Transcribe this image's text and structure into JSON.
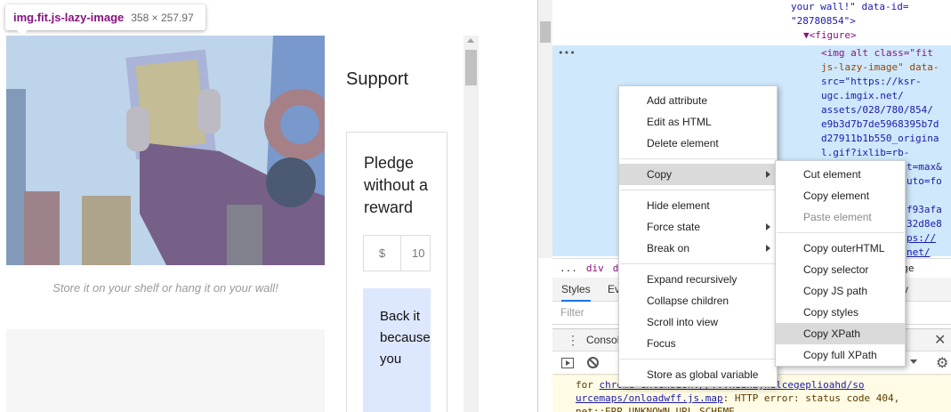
{
  "tooltip": {
    "selector": "img.fit.js-lazy-image",
    "dimensions": "358 × 257.97"
  },
  "page": {
    "caption": "Store it on your shelf or hang it on your wall!",
    "support_heading": "Support",
    "pledge_title": "Pledge without a reward",
    "currency": "$",
    "amount_value": "10",
    "back_button": "Back it because you"
  },
  "devtools": {
    "tree": {
      "l1": "your wall!\" data-id=",
      "l2": "\"28780854\">",
      "figure": "▼<figure>",
      "img": [
        "<img alt class=\"fit",
        "js-lazy-image\" data-",
        "src=\"https://ksr-",
        "ugc.imgix.net/",
        "assets/028/780/854/",
        "e9b3d7b7de5968395b7d",
        "d27911b1b550_origina",
        "l.gif?ixlib=rb-",
        "t=max&",
        "uto=fo",
        "",
        "f93afa",
        "32d8e8",
        "ps://",
        "net/"
      ],
      "ellipsis": "•••"
    },
    "breadcrumb": [
      "...",
      "div",
      "div",
      "mage"
    ],
    "styles_tabs": {
      "styles": "Styles",
      "event": "Eve",
      "access": "ity"
    },
    "filter_placeholder": "Filter",
    "console_tab": "Console",
    "console_warning": {
      "line1_pre": "for ",
      "line1_link": "chrome-extension://...kedhajhdlcegeplioahd/so",
      "line2_link": "urcemaps/onloadwff.js.map",
      "line2_rest": ": HTTP error: status code 404,",
      "line3": "net::ERR_UNKNOWN_URL_SCHEME"
    }
  },
  "context_menu": {
    "items": [
      "Add attribute",
      "Edit as HTML",
      "Delete element",
      "Copy",
      "Hide element",
      "Force state",
      "Break on",
      "Expand recursively",
      "Collapse children",
      "Scroll into view",
      "Focus",
      "Store as global variable"
    ],
    "highlighted": "Copy"
  },
  "copy_submenu": {
    "items": [
      "Cut element",
      "Copy element",
      "Paste element",
      "Copy outerHTML",
      "Copy selector",
      "Copy JS path",
      "Copy styles",
      "Copy XPath",
      "Copy full XPath"
    ],
    "highlighted": "Copy XPath",
    "disabled": "Paste element"
  }
}
